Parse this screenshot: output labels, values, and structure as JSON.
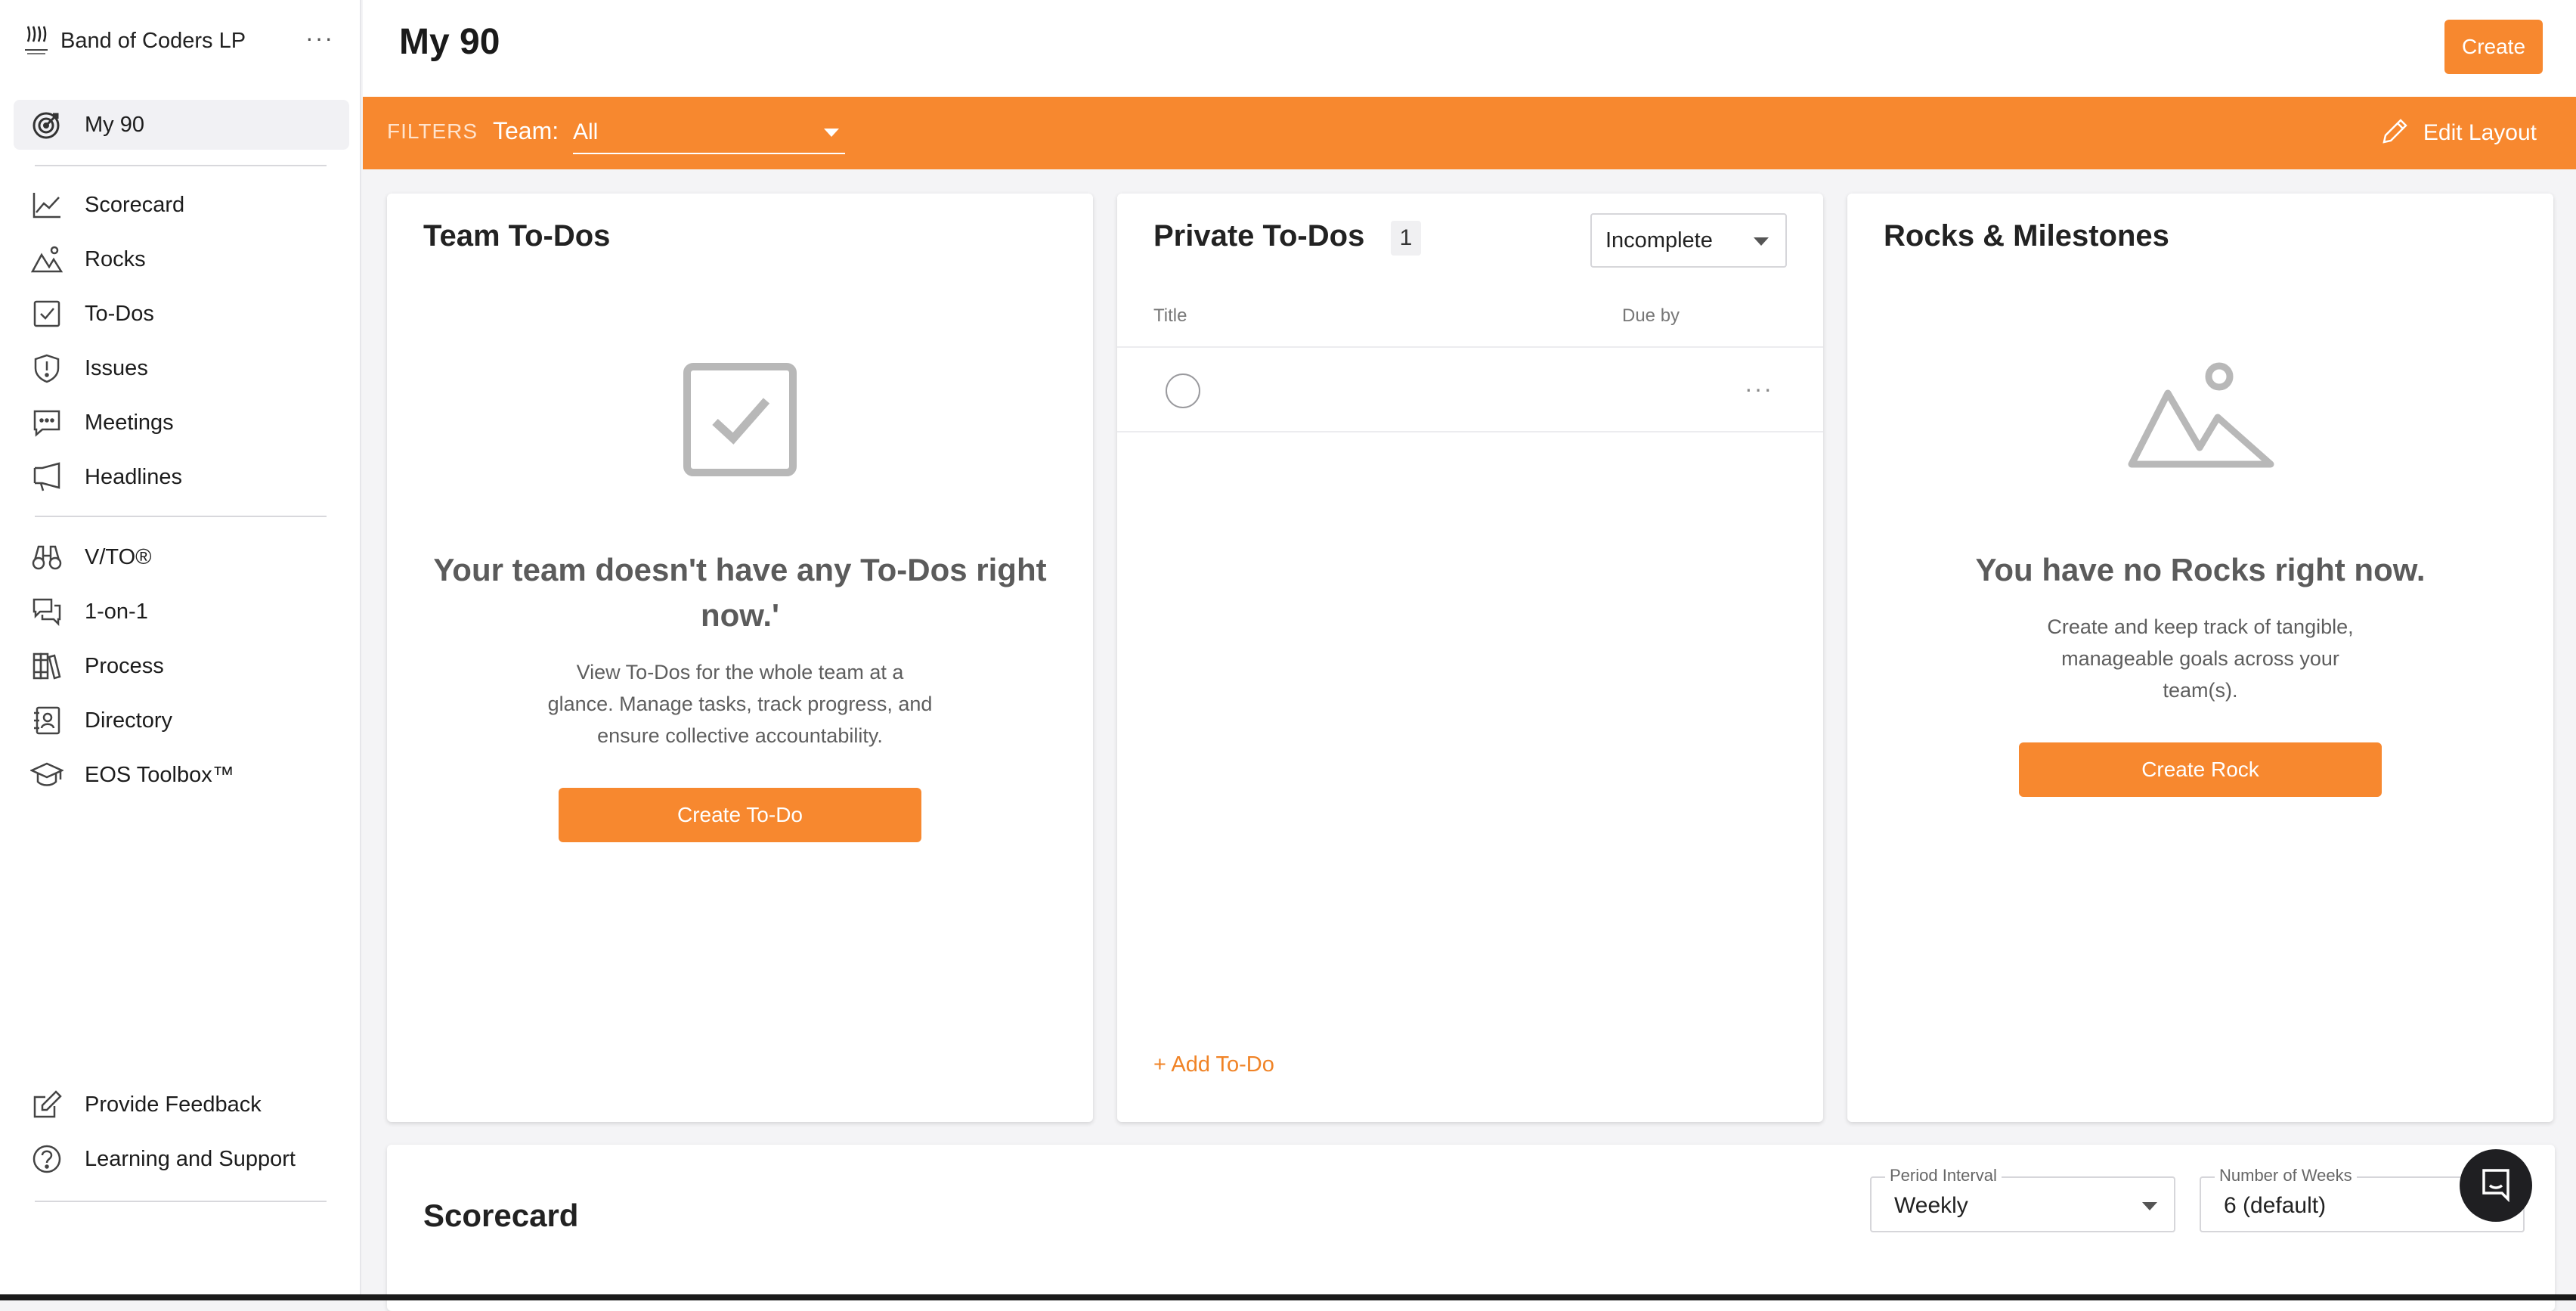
{
  "sidebar": {
    "org_name": "Band of Coders LP",
    "org_menu": "···",
    "active": {
      "label": "My 90",
      "icon": "target-icon"
    },
    "group1": [
      {
        "label": "Scorecard",
        "icon": "chart-line-icon"
      },
      {
        "label": "Rocks",
        "icon": "mountain-icon"
      },
      {
        "label": "To-Dos",
        "icon": "checkbox-icon"
      },
      {
        "label": "Issues",
        "icon": "shield-exclamation-icon"
      },
      {
        "label": "Meetings",
        "icon": "chat-dots-icon"
      },
      {
        "label": "Headlines",
        "icon": "megaphone-icon"
      }
    ],
    "group2": [
      {
        "label": "V/TO®",
        "icon": "binoculars-icon"
      },
      {
        "label": "1-on-1",
        "icon": "conversation-icon"
      },
      {
        "label": "Process",
        "icon": "books-icon"
      },
      {
        "label": "Directory",
        "icon": "contact-book-icon"
      },
      {
        "label": "EOS Toolbox™",
        "icon": "graduation-cap-icon"
      }
    ],
    "footer": [
      {
        "label": "Provide Feedback",
        "icon": "edit-square-icon"
      },
      {
        "label": "Learning and Support",
        "icon": "help-circle-icon"
      }
    ]
  },
  "header": {
    "title": "My 90",
    "create_label": "Create"
  },
  "filters": {
    "label": "FILTERS",
    "team_label": "Team:",
    "team_value": "All",
    "edit_layout": "Edit Layout"
  },
  "team_todos": {
    "title": "Team To-Dos",
    "empty_title": "Your team doesn't have any To-Dos right now.'",
    "empty_desc": "View To-Dos for the whole team at a glance. Manage tasks, track progress, and ensure collective accountability.",
    "button": "Create To-Do"
  },
  "private_todos": {
    "title": "Private To-Dos",
    "count": "1",
    "status_filter": "Incomplete",
    "col_title": "Title",
    "col_due": "Due by",
    "row_more": "···",
    "add_label": "+ Add To-Do"
  },
  "rocks": {
    "title": "Rocks & Milestones",
    "empty_title": "You have no Rocks right now.",
    "empty_desc": "Create and keep track of tangible, manageable goals across your team(s).",
    "button": "Create Rock"
  },
  "scorecard": {
    "title": "Scorecard",
    "period_label": "Period Interval",
    "period_value": "Weekly",
    "weeks_label": "Number of Weeks",
    "weeks_value": "6 (default)"
  },
  "colors": {
    "accent": "#f7882f",
    "sidebar_active_bg": "#f1f1f4",
    "chat_bubble": "#1f1f22"
  }
}
